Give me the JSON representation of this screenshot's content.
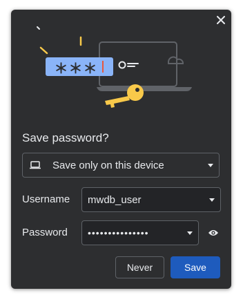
{
  "dialog": {
    "title": "Save password?",
    "close_icon": "close-icon"
  },
  "storage": {
    "icon": "laptop-icon",
    "selected": "Save only on this device"
  },
  "username": {
    "label": "Username",
    "value": "mwdb_user"
  },
  "password": {
    "label": "Password",
    "value": "•••••••••••••••",
    "reveal_icon": "eye-icon"
  },
  "buttons": {
    "never_label": "Never",
    "save_label": "Save"
  },
  "illustration": {
    "masked_text": "＊＊＊"
  },
  "colors": {
    "background": "#2d2e30",
    "primary": "#1e5bbd",
    "accent_yellow": "#f8c94a",
    "highlight_blue": "#8ab4f8"
  }
}
